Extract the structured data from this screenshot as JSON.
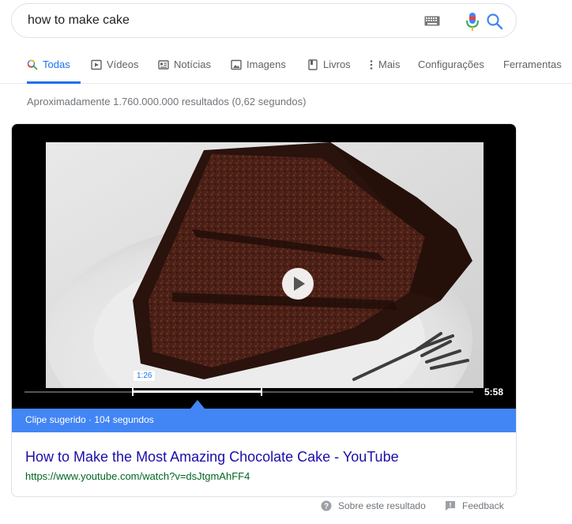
{
  "search": {
    "query": "how to make cake",
    "icons": [
      "keyboard-icon",
      "microphone-icon",
      "search-icon"
    ]
  },
  "tabs": [
    {
      "label": "Todas",
      "icon": "search-icon",
      "active": true
    },
    {
      "label": "Vídeos",
      "icon": "play-box-icon",
      "active": false
    },
    {
      "label": "Notícias",
      "icon": "newspaper-icon",
      "active": false
    },
    {
      "label": "Imagens",
      "icon": "image-icon",
      "active": false
    },
    {
      "label": "Livros",
      "icon": "book-icon",
      "active": false
    },
    {
      "label": "Mais",
      "icon": "more-vert-icon",
      "active": false
    },
    {
      "label": "Configurações",
      "active": false
    },
    {
      "label": "Ferramentas",
      "active": false
    }
  ],
  "stats": "Aproximadamente 1.760.000.000 resultados (0,62 segundos)",
  "video": {
    "clip_start": "1:26",
    "duration": "5:58",
    "clip_label": "Clipe sugerido · 104 segundos",
    "title": "How to Make the Most Amazing Chocolate Cake - YouTube",
    "url": "https://www.youtube.com/watch?v=dsJtgmAhFF4"
  },
  "footer": {
    "about": "Sobre este resultado",
    "feedback": "Feedback"
  },
  "colors": {
    "accent": "#1a73e8",
    "clip_bar": "#4285f4",
    "link": "#1a0dab",
    "url": "#006621"
  }
}
